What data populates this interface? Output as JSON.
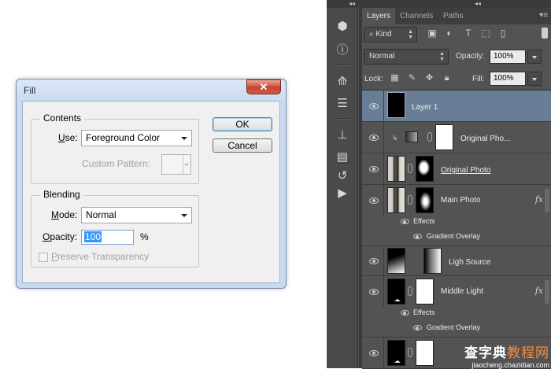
{
  "fill_dialog": {
    "title": "Fill",
    "close": "✕",
    "ok": "OK",
    "cancel": "Cancel",
    "contents": {
      "label": "Contents",
      "use_label_u": "U",
      "use_label_rest": "se:",
      "use_value": "Foreground Color",
      "custom_pattern": "Custom Pattern:"
    },
    "blending": {
      "label": "Blending",
      "mode_label_u": "M",
      "mode_label_rest": "ode:",
      "mode_value": "Normal",
      "opacity_label_u": "O",
      "opacity_label_rest": "pacity:",
      "opacity_value": "100",
      "opacity_unit": "%",
      "preserve_u": "P",
      "preserve_rest": "reserve Transparency",
      "preserve_checked": false
    }
  },
  "ps": {
    "collapse_left": "◂◂",
    "collapse_right": "◂◂",
    "tabs": [
      "Layers",
      "Channels",
      "Paths"
    ],
    "panel_menu": "▾≡",
    "filter_kind": "Kind",
    "blend_mode": "Normal",
    "opacity_label": "Opacity:",
    "opacity_value": "100%",
    "lock_label": "Lock:",
    "fill_label": "Fill:",
    "fill_value": "100%",
    "layers": [
      {
        "name": "Layer 1"
      },
      {
        "name": "Original Pho..."
      },
      {
        "name": "Original Photo"
      },
      {
        "name": "Main Photo",
        "fx": "fx",
        "effects_label": "Effects",
        "effect": "Gradient Overlay"
      },
      {
        "name": "Ligh Source"
      },
      {
        "name": "Middle Light",
        "fx": "fx",
        "effects_label": "Effects",
        "effect": "Gradient Overlay"
      },
      {
        "name": ""
      }
    ]
  },
  "watermark": {
    "line1_a": "查字典",
    "line1_b": "教程网",
    "line2": "jiaocheng.chazidian.com"
  }
}
